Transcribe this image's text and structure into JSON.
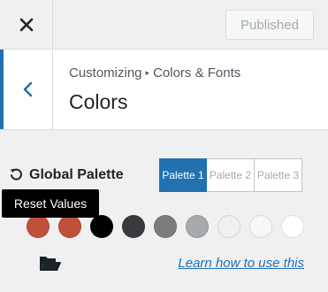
{
  "topbar": {
    "close_icon": "close-icon",
    "publish_label": "Published"
  },
  "section": {
    "breadcrumb_parent": "Customizing",
    "breadcrumb_separator": "▸",
    "breadcrumb_current": "Colors & Fonts",
    "title": "Colors",
    "back_icon": "chevron-left-icon",
    "accent_color": "#2271b1"
  },
  "palette": {
    "label": "Global Palette",
    "reset_icon": "reset-icon",
    "tabs": [
      {
        "label": "Palette 1",
        "active": true
      },
      {
        "label": "Palette 2",
        "active": false
      },
      {
        "label": "Palette 3",
        "active": false
      }
    ],
    "tooltip": "Reset Values",
    "swatches": [
      "#c0503a",
      "#c0503a",
      "#000000",
      "#383a3d",
      "#7b7c7e",
      "#a7aaad",
      "#f0f0f1",
      "#f6f7f7",
      "#ffffff"
    ],
    "folder_icon": "folder-open-icon",
    "learn_link": "Learn how to use this"
  }
}
